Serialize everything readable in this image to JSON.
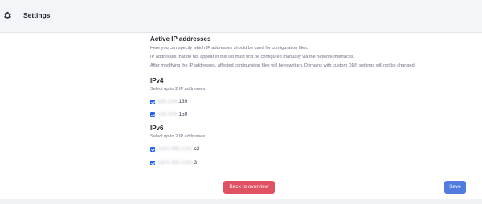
{
  "header": {
    "title": "Settings",
    "icon": "gear-icon"
  },
  "main": {
    "section_title": "Active IP addresses",
    "description": [
      "Here you can specify which IP addresses should be used for configuration files.",
      "IP addresses that do not appear in this list must first be configured manually via the network interfaces.",
      "After modifying the IP addresses, affected configuration files will be rewritten. Domains with custom DNS settings will not be changed."
    ],
    "ipv4": {
      "title": "IPv4",
      "hint": "Select up to 2 IP addresses.",
      "items": [
        {
          "masked": "116.204.",
          "suffix": "139",
          "checked": true
        },
        {
          "masked": "116.204.",
          "suffix": "150",
          "checked": true
        }
      ]
    },
    "ipv6": {
      "title": "IPv6",
      "hint": "Select up to 2 IP addresses.",
      "items": [
        {
          "masked": "2a01:4f8:1c0c:",
          "suffix": "c2",
          "checked": true
        },
        {
          "masked": "2a01:4f8:1c0c:",
          "suffix": "3",
          "checked": true
        }
      ]
    }
  },
  "actions": {
    "back_label": "Back to overview",
    "save_label": "Save",
    "back_color": "#e05263",
    "save_color": "#4f7cdd"
  }
}
